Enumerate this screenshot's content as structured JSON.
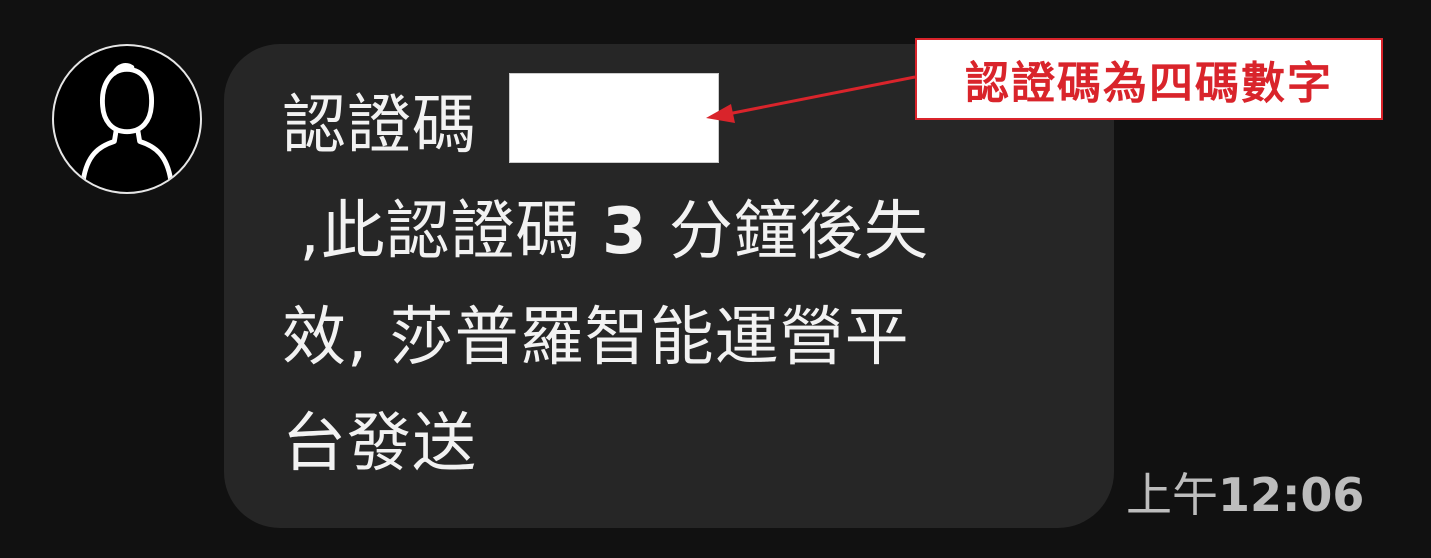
{
  "message": {
    "line1": "認證碼",
    "line2_pre": " ,此認證碼 ",
    "line2_num": "3",
    "line2_post": " 分鐘後失",
    "line3": "效, 莎普羅智能運營平",
    "line4": "台發送"
  },
  "timestamp": {
    "period": "上午",
    "clock": "12:06"
  },
  "annotation": {
    "text": "認證碼為四碼數字",
    "color": "#d9242b"
  },
  "icons": {
    "avatar": "user-silhouette-icon",
    "arrow": "arrow-left-icon"
  }
}
